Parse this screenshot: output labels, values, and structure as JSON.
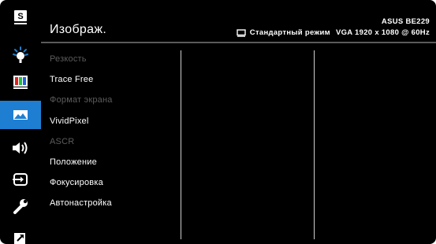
{
  "sidebar": {
    "items": [
      {
        "icon": "splendid-icon",
        "label": "S",
        "active": false
      },
      {
        "icon": "blue-light-filter-icon",
        "active": false
      },
      {
        "icon": "color-icon",
        "active": false
      },
      {
        "icon": "image-icon",
        "active": true
      },
      {
        "icon": "sound-icon",
        "active": false
      },
      {
        "icon": "input-select-icon",
        "active": false
      },
      {
        "icon": "system-setup-icon",
        "active": false
      },
      {
        "icon": "shortcut-icon",
        "active": false
      }
    ]
  },
  "header": {
    "title": "Изображ.",
    "model": "ASUS BE229",
    "mode": "Стандартный режим",
    "resolution": "VGA 1920 x 1080 @ 60Hz"
  },
  "menu": {
    "items": [
      {
        "label": "Резкость",
        "enabled": false
      },
      {
        "label": "Trace Free",
        "enabled": true
      },
      {
        "label": "Формат экрана",
        "enabled": false
      },
      {
        "label": "VividPixel",
        "enabled": true
      },
      {
        "label": "ASCR",
        "enabled": false
      },
      {
        "label": "Положение",
        "enabled": true
      },
      {
        "label": "Фокусировка",
        "enabled": true
      },
      {
        "label": "Автонастройка",
        "enabled": true
      }
    ]
  },
  "colors": {
    "background": "#000000",
    "accent": "#1e7fd2",
    "text": "#ffffff",
    "disabled_text": "#5c5c5c",
    "divider": "#5a5a5a"
  }
}
